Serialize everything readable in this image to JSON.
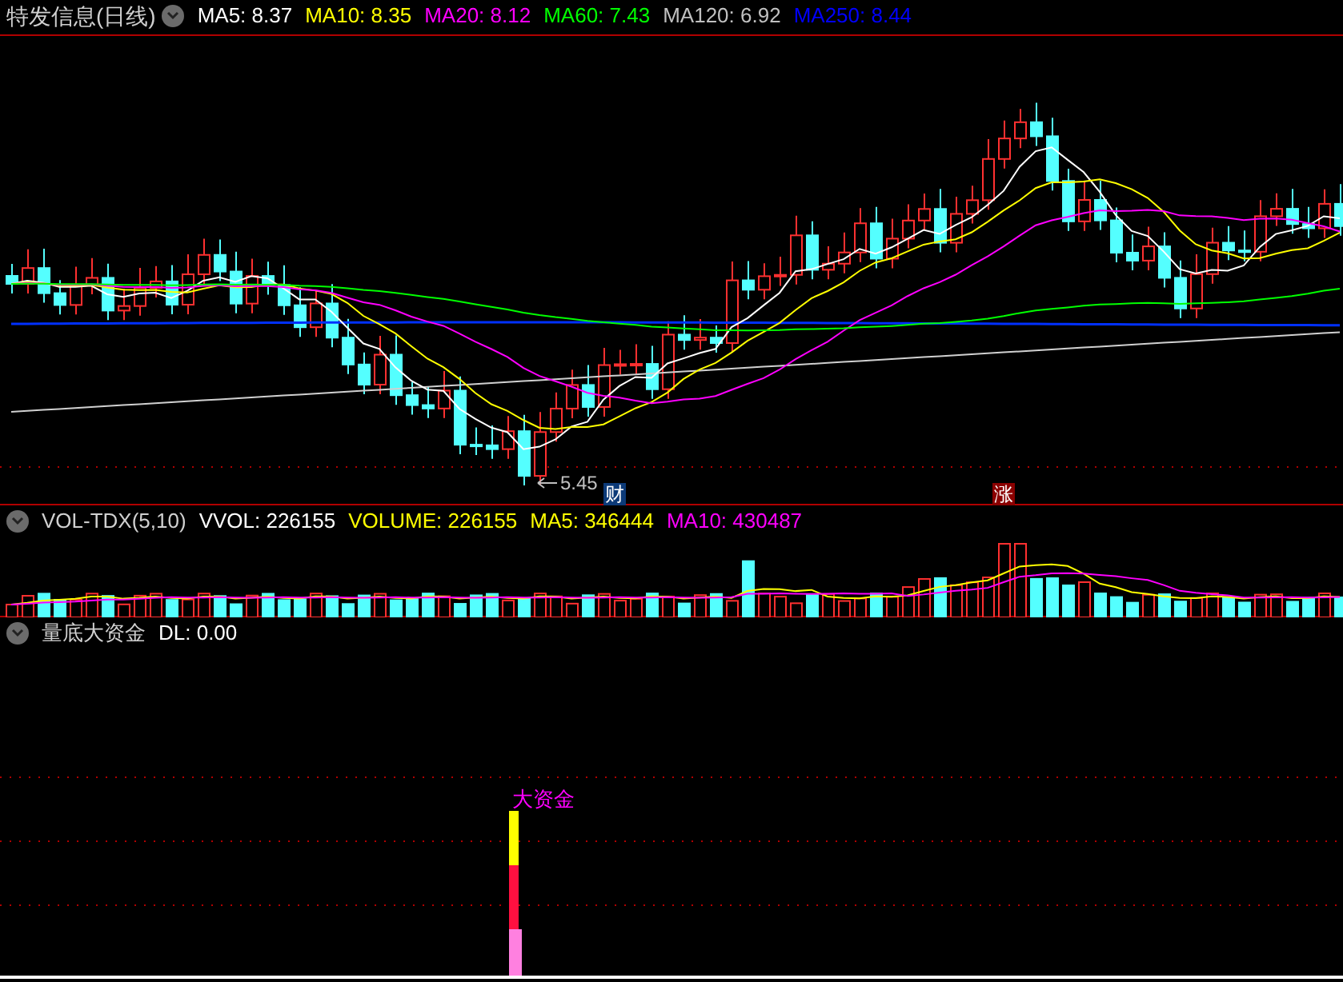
{
  "price_panel": {
    "title": "特发信息(日线)",
    "indicators": [
      {
        "label": "MA5: 8.37",
        "color": "#ffffff"
      },
      {
        "label": "MA10: 8.35",
        "color": "#ffff00"
      },
      {
        "label": "MA20: 8.12",
        "color": "#ff00ff"
      },
      {
        "label": "MA60: 7.43",
        "color": "#00ff00"
      },
      {
        "label": "MA120: 6.92",
        "color": "#c0c0c0"
      },
      {
        "label": "MA250: 8.44",
        "color": "#0000ff"
      }
    ],
    "low_marker": "5.45",
    "badges": [
      {
        "text": "财",
        "kind": "finance"
      },
      {
        "text": "涨",
        "kind": "rise"
      }
    ]
  },
  "volume_panel": {
    "title": "VOL-TDX(5,10)",
    "indicators": [
      {
        "label": "VVOL: 226155",
        "color": "#ffffff"
      },
      {
        "label": "VOLUME: 226155",
        "color": "#ffff00"
      },
      {
        "label": "MA5: 346444",
        "color": "#ffff00"
      },
      {
        "label": "MA10: 430487",
        "color": "#ff00ff"
      }
    ]
  },
  "fund_panel": {
    "title": "量底大资金",
    "indicators": [
      {
        "label": "DL: 0.00",
        "color": "#ffffff"
      }
    ],
    "signal_label": "大资金"
  }
}
